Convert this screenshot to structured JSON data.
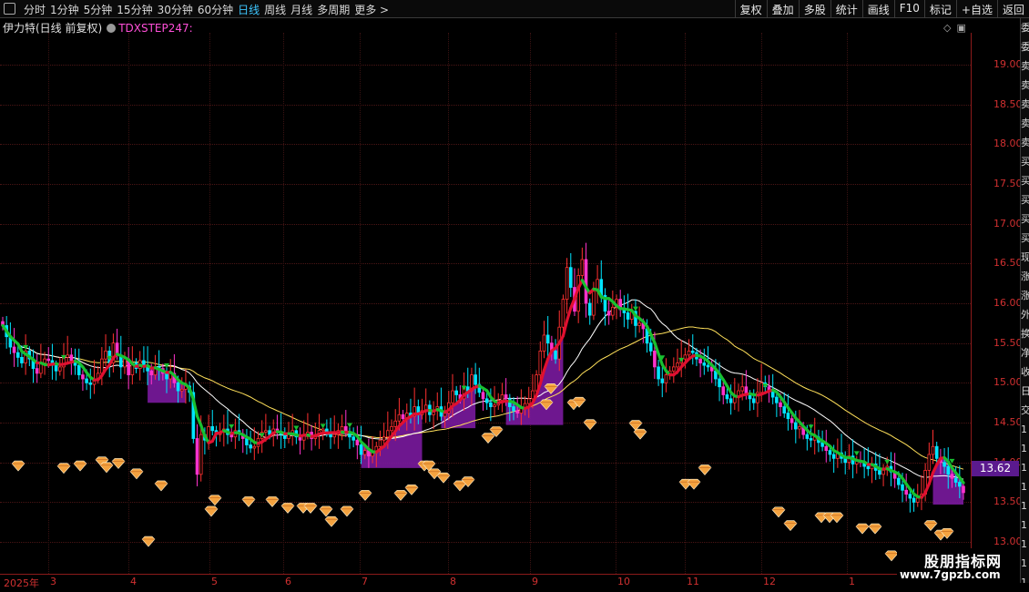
{
  "toolbar": {
    "periods": [
      {
        "label": "分时",
        "active": false
      },
      {
        "label": "1分钟",
        "active": false
      },
      {
        "label": "5分钟",
        "active": false
      },
      {
        "label": "15分钟",
        "active": false
      },
      {
        "label": "30分钟",
        "active": false
      },
      {
        "label": "60分钟",
        "active": false
      },
      {
        "label": "日线",
        "active": true
      },
      {
        "label": "周线",
        "active": false
      },
      {
        "label": "月线",
        "active": false
      },
      {
        "label": "多周期",
        "active": false
      }
    ],
    "more_label": "更多 >",
    "tools": [
      "复权",
      "叠加",
      "多股",
      "统计",
      "画线",
      "F10",
      "标记",
      "+自选",
      "返回"
    ]
  },
  "stock": {
    "title": "伊力特(日线 前复权)",
    "indicator": "TDXSTEP247:"
  },
  "axis": {
    "price_labels": [
      "19.00",
      "18.50",
      "18.00",
      "17.50",
      "17.00",
      "16.50",
      "16.00",
      "15.50",
      "15.00",
      "14.50",
      "14.00",
      "13.50",
      "13.00"
    ],
    "current_price": "13.62",
    "time_labels": [
      "2025年",
      "3",
      "4",
      "5",
      "6",
      "7",
      "8",
      "9",
      "10",
      "11",
      "12",
      "1"
    ]
  },
  "edge_strip": [
    "委",
    "委",
    "卖",
    "卖",
    "卖",
    "卖",
    "卖",
    "买",
    "买",
    "买",
    "买",
    "买",
    "现",
    "涨",
    "涨",
    "外",
    "换",
    "净",
    "收",
    "日",
    "交",
    "1",
    "1",
    "1",
    "1",
    "1",
    "1",
    "1",
    "1",
    "1"
  ],
  "watermark": {
    "name": "股朋指标网",
    "url": "www.7gpzb.com"
  },
  "colors": {
    "up": "#ff3030",
    "down": "#00e5ff",
    "magenta": "#ff33cc",
    "step_up": "#e01030",
    "step_down": "#18c030",
    "fill": "#7a1a9e",
    "ma_white": "#ffffff",
    "ma_yellow": "#ffe05a",
    "diamond": "#f4a340"
  },
  "chart_data": {
    "type": "candlestick",
    "ylim": [
      12.6,
      19.4
    ],
    "candles_close": [
      15.72,
      15.58,
      15.45,
      15.38,
      15.32,
      15.25,
      15.4,
      15.3,
      15.18,
      15.12,
      15.25,
      15.3,
      15.28,
      15.22,
      15.15,
      15.2,
      15.32,
      15.35,
      15.28,
      15.22,
      15.1,
      15.05,
      15.0,
      14.98,
      15.05,
      15.12,
      15.3,
      15.4,
      15.25,
      15.5,
      15.35,
      15.2,
      15.3,
      15.1,
      15.25,
      15.18,
      15.28,
      15.22,
      15.15,
      15.1,
      15.2,
      15.18,
      15.12,
      15.05,
      15.12,
      15.0,
      14.9,
      14.92,
      14.96,
      14.88,
      14.3,
      13.85,
      14.35,
      14.28,
      14.45,
      14.4,
      14.35,
      14.38,
      14.42,
      14.35,
      14.32,
      14.4,
      14.36,
      14.3,
      14.22,
      14.18,
      14.2,
      14.3,
      14.38,
      14.4,
      14.35,
      14.42,
      14.38,
      14.35,
      14.3,
      14.36,
      14.4,
      14.32,
      14.28,
      14.35,
      14.38,
      14.3,
      14.35,
      14.4,
      14.42,
      14.38,
      14.32,
      14.35,
      14.4,
      14.45,
      14.38,
      14.32,
      14.28,
      14.22,
      14.1,
      14.15,
      14.08,
      14.12,
      14.2,
      14.28,
      14.32,
      14.4,
      14.45,
      14.52,
      14.6,
      14.55,
      14.62,
      14.58,
      14.7,
      14.6,
      14.65,
      14.72,
      14.6,
      14.65,
      14.7,
      14.58,
      14.62,
      14.75,
      14.9,
      14.85,
      14.8,
      14.95,
      14.9,
      15.1,
      14.98,
      14.88,
      14.8,
      14.75,
      14.7,
      14.72,
      14.78,
      14.85,
      14.8,
      14.7,
      14.65,
      14.62,
      14.68,
      14.74,
      14.8,
      14.9,
      15.1,
      15.4,
      15.6,
      15.5,
      15.4,
      15.3,
      15.7,
      16.05,
      16.45,
      16.2,
      15.9,
      16.35,
      16.55,
      16.0,
      15.85,
      16.15,
      16.3,
      16.1,
      15.9,
      15.85,
      15.95,
      16.05,
      15.92,
      15.88,
      15.8,
      15.9,
      15.72,
      15.75,
      15.68,
      15.5,
      15.4,
      15.2,
      15.05,
      15.0,
      15.1,
      15.15,
      15.2,
      15.25,
      15.3,
      15.35,
      15.4,
      15.38,
      15.3,
      15.25,
      15.22,
      15.2,
      15.15,
      15.05,
      14.95,
      14.85,
      14.8,
      14.75,
      14.82,
      14.9,
      14.95,
      14.85,
      14.8,
      14.75,
      14.88,
      15.0,
      14.95,
      14.9,
      14.82,
      14.75,
      14.7,
      14.62,
      14.55,
      14.5,
      14.42,
      14.45,
      14.35,
      14.3,
      14.28,
      14.32,
      14.25,
      14.2,
      14.15,
      14.1,
      14.05,
      14.12,
      14.05,
      14.0,
      14.08,
      13.98,
      14.02,
      14.0,
      13.95,
      13.92,
      13.98,
      13.9,
      13.85,
      13.92,
      13.95,
      13.88,
      13.8,
      13.72,
      13.65,
      13.6,
      13.55,
      13.5,
      13.55,
      13.6,
      13.9,
      14.1,
      14.2,
      14.05,
      14.0,
      13.95,
      13.85,
      13.8,
      13.75,
      13.7,
      13.62
    ]
  }
}
